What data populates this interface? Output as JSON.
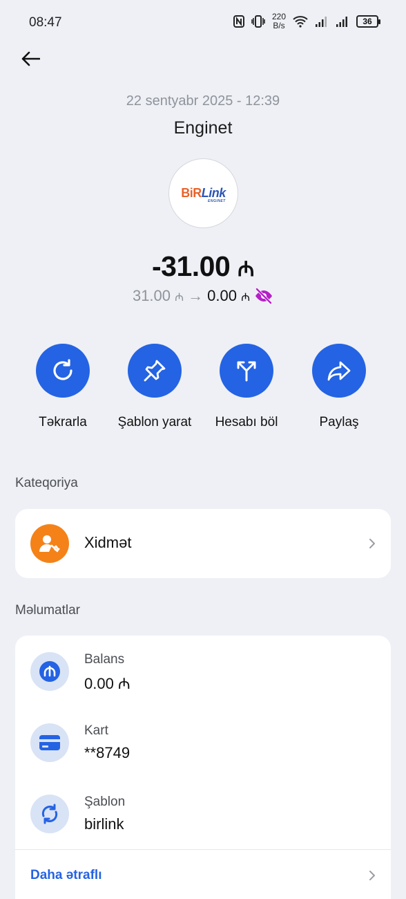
{
  "status_bar": {
    "time": "08:47",
    "net_speed_value": "220",
    "net_speed_unit": "B/s",
    "battery": "36",
    "icons": [
      "nfc-icon",
      "vibrate-icon",
      "wifi-icon",
      "signal-icon",
      "signal-icon",
      "battery-icon"
    ]
  },
  "transaction": {
    "date": "22 sentyabr 2025 - 12:39",
    "merchant": "Enginet",
    "logo_main_left": "BiR",
    "logo_main_right": "Link",
    "logo_sub": "ENGINET",
    "amount": "-31.00",
    "currency_symbol": "₼",
    "balance_from": "31.00",
    "arrow": "→",
    "balance_to": "0.00"
  },
  "actions": [
    {
      "label": "Təkrarla",
      "icon": "refresh-icon"
    },
    {
      "label": "Şablon yarat",
      "icon": "pin-icon"
    },
    {
      "label": "Hesabı böl",
      "icon": "split-icon"
    },
    {
      "label": "Paylaş",
      "icon": "share-icon"
    }
  ],
  "category": {
    "title": "Kateqoriya",
    "label": "Xidmət",
    "icon": "user-wrench-icon",
    "color": "#f48218"
  },
  "details": {
    "title": "Məlumatlar",
    "rows": [
      {
        "label": "Balans",
        "value": "0.00 ₼",
        "icon": "manat-icon"
      },
      {
        "label": "Kart",
        "value": "**8749",
        "icon": "card-icon"
      },
      {
        "label": "Şablon",
        "value": "birlink",
        "icon": "repeat-icon"
      }
    ],
    "more_label": "Daha ətraflı"
  },
  "colors": {
    "background": "#eef0f5",
    "accent": "#2463e3",
    "hidden_icon": "#b620c8"
  }
}
